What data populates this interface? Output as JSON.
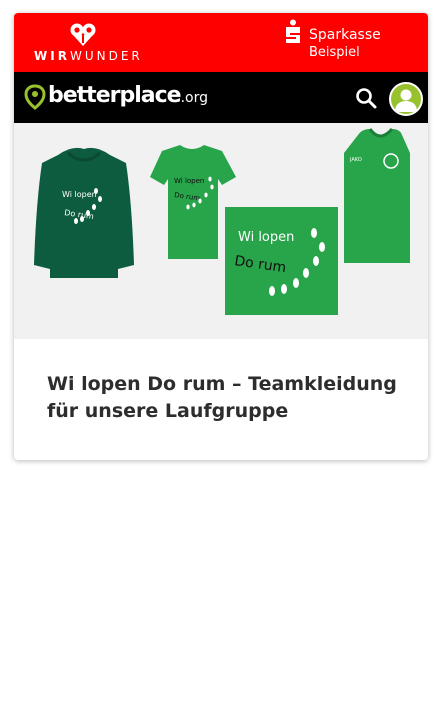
{
  "partner_logo": {
    "part1": "WIR",
    "part2": "WUNDER"
  },
  "bank_logo": {
    "name": "Sparkasse",
    "sub": "Beispiel"
  },
  "brand": {
    "name": "betterplace",
    "tld": ".org"
  },
  "hero_image": {
    "print_line1": "Wi lopen",
    "print_line2": "Do rum",
    "jersey_brand": "JAKO"
  },
  "project": {
    "title": "Wi lopen Do rum – Teamkleidung für unsere Laufgruppe"
  },
  "colors": {
    "bar": "#ff0000",
    "navbar": "#000000",
    "accent": "#97c22e",
    "shirt_dark": "#0d5c3f",
    "shirt_green": "#28a44a"
  }
}
